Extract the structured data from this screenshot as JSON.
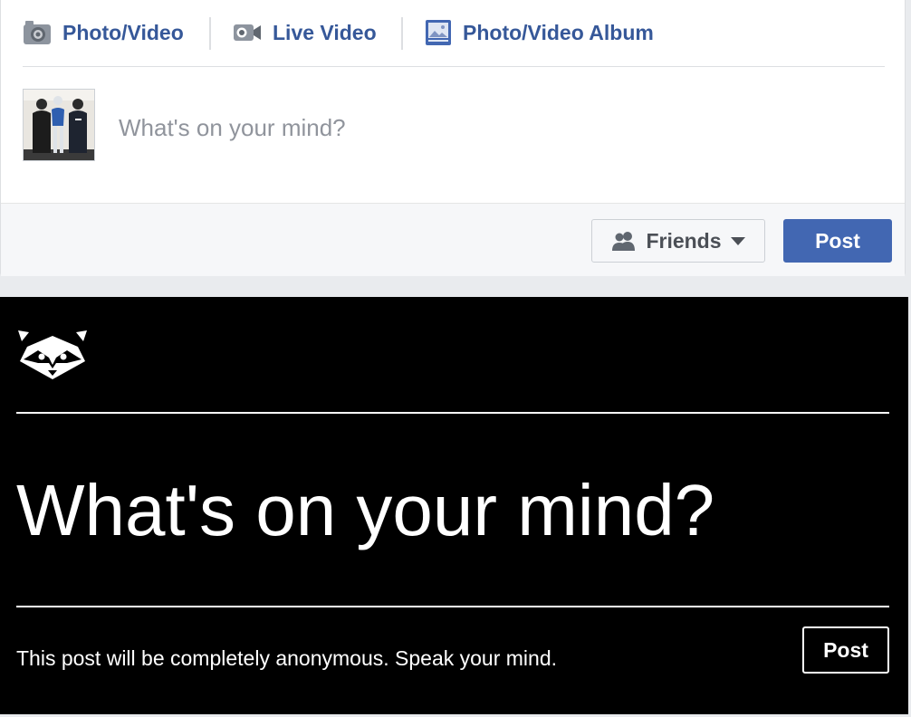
{
  "composer": {
    "tabs": [
      {
        "label": "Photo/Video",
        "icon": "camera-icon"
      },
      {
        "label": "Live Video",
        "icon": "video-camera-icon"
      },
      {
        "label": "Photo/Video Album",
        "icon": "photo-album-icon"
      }
    ],
    "placeholder": "What's on your mind?",
    "audience_label": "Friends",
    "audience_icon": "friends-icon",
    "post_label": "Post",
    "colors": {
      "link": "#365899",
      "post_button": "#4267b2",
      "muted": "#90949c"
    }
  },
  "anonymous": {
    "logo_icon": "raccoon-logo-icon",
    "placeholder": "What's on your mind?",
    "note": "This post will be completely anonymous. Speak your mind.",
    "post_label": "Post",
    "colors": {
      "background": "#000000",
      "text": "#ffffff"
    }
  }
}
